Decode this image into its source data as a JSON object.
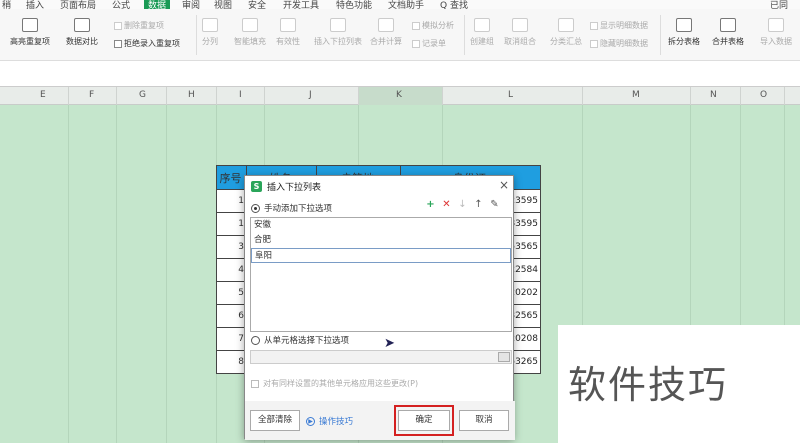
{
  "menubar": {
    "items": [
      {
        "label": "稍",
        "active": false
      },
      {
        "label": "插入",
        "active": false
      },
      {
        "label": "页面布局",
        "active": false
      },
      {
        "label": "公式",
        "active": false
      },
      {
        "label": "数据",
        "active": true
      },
      {
        "label": "审阅",
        "active": false
      },
      {
        "label": "视图",
        "active": false
      },
      {
        "label": "安全",
        "active": false
      },
      {
        "label": "开发工具",
        "active": false
      },
      {
        "label": "特色功能",
        "active": false
      },
      {
        "label": "文档助手",
        "active": false
      },
      {
        "label": "Q 查找",
        "active": false
      },
      {
        "label": "已同",
        "active": false
      }
    ]
  },
  "ribbon": {
    "highlight_dup": "高亮重复项",
    "data_compare": "数据对比",
    "delete_dup": "删除重复项",
    "reject_dup": "拒绝录入重复项",
    "split_col": "分列",
    "smart_fill": "智能填充",
    "validity": "有效性",
    "insert_dropdown": "插入下拉列表",
    "merge_calc": "合并计算",
    "simulate": "模拟分析",
    "record": "记录单",
    "create_group": "创建组",
    "ungroup": "取消组合",
    "subtotal": "分类汇总",
    "show_detail": "显示明细数据",
    "hide_detail": "隐藏明细数据",
    "split_table": "拆分表格",
    "merge_table": "合并表格",
    "import_data": "导入数据"
  },
  "columns": [
    "E",
    "F",
    "G",
    "H",
    "I",
    "J",
    "K",
    "L",
    "M",
    "N",
    "O"
  ],
  "table": {
    "headers": [
      "序号",
      "姓名",
      "户籍地",
      "身份证"
    ],
    "rows": [
      {
        "seq": "1",
        "id": "511023595"
      },
      {
        "seq": "1",
        "id": "511083595"
      },
      {
        "seq": "3",
        "id": "302053565"
      },
      {
        "seq": "4",
        "id": "208122584"
      },
      {
        "seq": "5",
        "id": "212120202"
      },
      {
        "seq": "6",
        "id": "204232565"
      },
      {
        "seq": "7",
        "id": "212120208"
      },
      {
        "seq": "8",
        "id": "212253265"
      }
    ]
  },
  "dialog": {
    "title": "插入下拉列表",
    "close": "×",
    "option_manual": "手动添加下拉选项",
    "list_items": [
      "安徽",
      "合肥",
      "阜阳"
    ],
    "selected_index": 2,
    "option_cell": "从单元格选择下拉选项",
    "apply_all": "对有同样设置的其他单元格应用这些更改(P)",
    "clear_all": "全部清除",
    "tips": "操作技巧",
    "ok": "确定",
    "cancel": "取消",
    "tool_icons": [
      "add-icon",
      "delete-icon",
      "move-down-icon",
      "move-up-icon",
      "edit-icon"
    ]
  },
  "watermark": "软件技巧",
  "colors": {
    "accent": "#1a9a55",
    "grid_bg": "#c5e6cc",
    "header_blue": "#1f9ee0",
    "highlight_red": "#d42020"
  }
}
